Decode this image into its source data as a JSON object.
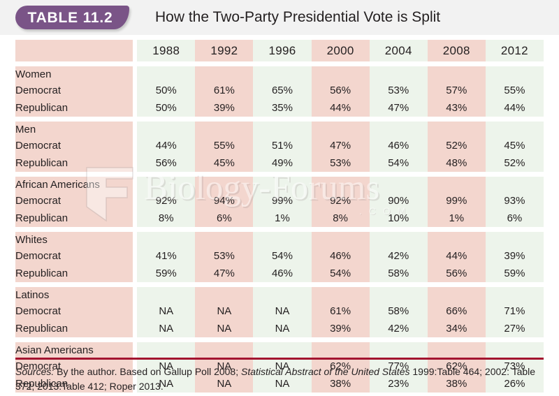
{
  "header": {
    "badge_label": "TABLE 11.2",
    "title": "How the Two-Party Presidential Vote is Split",
    "badge_color": "#7a5487",
    "title_band_color": "#f2f2f2"
  },
  "colors": {
    "pink_column": "#f3d6ce",
    "green_column": "#edf4eb",
    "bottom_rule": "#a3142f",
    "text": "#231f20"
  },
  "chart_data": {
    "type": "table",
    "title": "How the Two-Party Presidential Vote is Split",
    "corner_label": "",
    "categories": [
      "1988",
      "1992",
      "1996",
      "2000",
      "2004",
      "2008",
      "2012"
    ],
    "row_label_header": "",
    "groups": [
      {
        "name": "Women",
        "rows": [
          {
            "label": "Democrat",
            "values": [
              "50%",
              "61%",
              "65%",
              "56%",
              "53%",
              "57%",
              "55%"
            ]
          },
          {
            "label": "Republican",
            "values": [
              "50%",
              "39%",
              "35%",
              "44%",
              "47%",
              "43%",
              "44%"
            ]
          }
        ]
      },
      {
        "name": "Men",
        "rows": [
          {
            "label": "Democrat",
            "values": [
              "44%",
              "55%",
              "51%",
              "47%",
              "46%",
              "52%",
              "45%"
            ]
          },
          {
            "label": "Republican",
            "values": [
              "56%",
              "45%",
              "49%",
              "53%",
              "54%",
              "48%",
              "52%"
            ]
          }
        ]
      },
      {
        "name": "African Americans",
        "rows": [
          {
            "label": "Democrat",
            "values": [
              "92%",
              "94%",
              "99%",
              "92%",
              "90%",
              "99%",
              "93%"
            ]
          },
          {
            "label": "Republican",
            "values": [
              "8%",
              "6%",
              "1%",
              "8%",
              "10%",
              "1%",
              "6%"
            ]
          }
        ]
      },
      {
        "name": "Whites",
        "rows": [
          {
            "label": "Democrat",
            "values": [
              "41%",
              "53%",
              "54%",
              "46%",
              "42%",
              "44%",
              "39%"
            ]
          },
          {
            "label": "Republican",
            "values": [
              "59%",
              "47%",
              "46%",
              "54%",
              "58%",
              "56%",
              "59%"
            ]
          }
        ]
      },
      {
        "name": "Latinos",
        "rows": [
          {
            "label": "Democrat",
            "values": [
              "NA",
              "NA",
              "NA",
              "61%",
              "58%",
              "66%",
              "71%"
            ]
          },
          {
            "label": "Republican",
            "values": [
              "NA",
              "NA",
              "NA",
              "39%",
              "42%",
              "34%",
              "27%"
            ]
          }
        ]
      },
      {
        "name": "Asian Americans",
        "rows": [
          {
            "label": "Democrat",
            "values": [
              "NA",
              "NA",
              "NA",
              "62%",
              "77%",
              "62%",
              "73%"
            ]
          },
          {
            "label": "Republican",
            "values": [
              "NA",
              "NA",
              "NA",
              "38%",
              "23%",
              "38%",
              "26%"
            ]
          }
        ]
      }
    ]
  },
  "source": {
    "lead": "Sources:",
    "part1": " By the author. Based on Gallup Poll 2008; ",
    "italic": "Statistical Abstract of the United States",
    "part2": " 1999:Table 464; 2002: Table 372; 2013:Table 412; Roper 2013."
  },
  "watermark": {
    "text": "Biology-Forums",
    "dotcom": ". C O M"
  }
}
